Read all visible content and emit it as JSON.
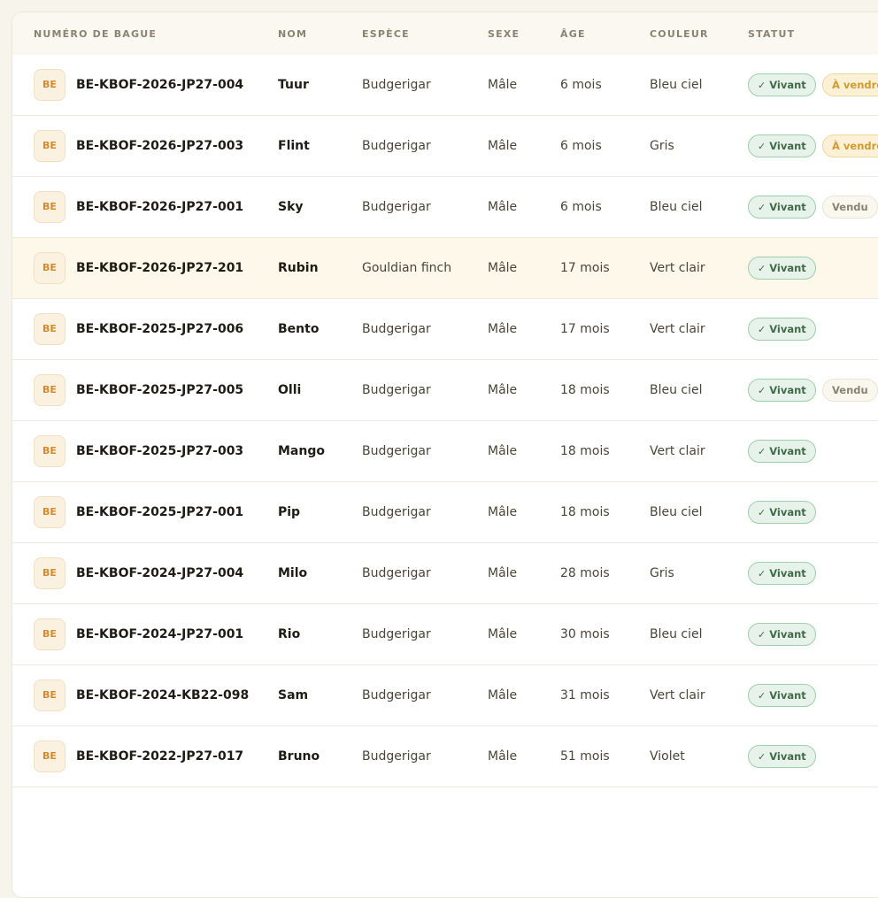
{
  "table": {
    "columns": [
      "Numéro de bague",
      "Nom",
      "Espèce",
      "Sexe",
      "Âge",
      "Couleur",
      "Statut"
    ],
    "rows": [
      {
        "country": "BE",
        "ring": "BE-KBOF-2026-JP27-004",
        "name": "Tuur",
        "species": "Budgerigar",
        "sex": "Mâle",
        "age": "6 mois",
        "color": "Bleu ciel",
        "status": "Vivant",
        "extra": "À vendre",
        "extra_type": "avendre",
        "highlight": false
      },
      {
        "country": "BE",
        "ring": "BE-KBOF-2026-JP27-003",
        "name": "Flint",
        "species": "Budgerigar",
        "sex": "Mâle",
        "age": "6 mois",
        "color": "Gris",
        "status": "Vivant",
        "extra": "À vendre",
        "extra_type": "avendre",
        "highlight": false
      },
      {
        "country": "BE",
        "ring": "BE-KBOF-2026-JP27-001",
        "name": "Sky",
        "species": "Budgerigar",
        "sex": "Mâle",
        "age": "6 mois",
        "color": "Bleu ciel",
        "status": "Vivant",
        "extra": "Vendu",
        "extra_type": "vendu",
        "highlight": false
      },
      {
        "country": "BE",
        "ring": "BE-KBOF-2026-JP27-201",
        "name": "Rubin",
        "species": "Gouldian finch",
        "sex": "Mâle",
        "age": "17 mois",
        "color": "Vert clair",
        "status": "Vivant",
        "extra": "",
        "extra_type": "",
        "highlight": true
      },
      {
        "country": "BE",
        "ring": "BE-KBOF-2025-JP27-006",
        "name": "Bento",
        "species": "Budgerigar",
        "sex": "Mâle",
        "age": "17 mois",
        "color": "Vert clair",
        "status": "Vivant",
        "extra": "",
        "extra_type": "",
        "highlight": false
      },
      {
        "country": "BE",
        "ring": "BE-KBOF-2025-JP27-005",
        "name": "Olli",
        "species": "Budgerigar",
        "sex": "Mâle",
        "age": "18 mois",
        "color": "Bleu ciel",
        "status": "Vivant",
        "extra": "Vendu",
        "extra_type": "vendu",
        "highlight": false
      },
      {
        "country": "BE",
        "ring": "BE-KBOF-2025-JP27-003",
        "name": "Mango",
        "species": "Budgerigar",
        "sex": "Mâle",
        "age": "18 mois",
        "color": "Vert clair",
        "status": "Vivant",
        "extra": "",
        "extra_type": "",
        "highlight": false
      },
      {
        "country": "BE",
        "ring": "BE-KBOF-2025-JP27-001",
        "name": "Pip",
        "species": "Budgerigar",
        "sex": "Mâle",
        "age": "18 mois",
        "color": "Bleu ciel",
        "status": "Vivant",
        "extra": "",
        "extra_type": "",
        "highlight": false
      },
      {
        "country": "BE",
        "ring": "BE-KBOF-2024-JP27-004",
        "name": "Milo",
        "species": "Budgerigar",
        "sex": "Mâle",
        "age": "28 mois",
        "color": "Gris",
        "status": "Vivant",
        "extra": "",
        "extra_type": "",
        "highlight": false
      },
      {
        "country": "BE",
        "ring": "BE-KBOF-2024-JP27-001",
        "name": "Rio",
        "species": "Budgerigar",
        "sex": "Mâle",
        "age": "30 mois",
        "color": "Bleu ciel",
        "status": "Vivant",
        "extra": "",
        "extra_type": "",
        "highlight": false
      },
      {
        "country": "BE",
        "ring": "BE-KBOF-2024-KB22-098",
        "name": "Sam",
        "species": "Budgerigar",
        "sex": "Mâle",
        "age": "31 mois",
        "color": "Vert clair",
        "status": "Vivant",
        "extra": "",
        "extra_type": "",
        "highlight": false
      },
      {
        "country": "BE",
        "ring": "BE-KBOF-2022-JP27-017",
        "name": "Bruno",
        "species": "Budgerigar",
        "sex": "Mâle",
        "age": "51 mois",
        "color": "Violet",
        "status": "Vivant",
        "extra": "",
        "extra_type": "",
        "highlight": false
      }
    ]
  },
  "icons": {
    "status_check": "check-icon"
  },
  "colors": {
    "background": "#f7f4ec",
    "highlight_row": "#fdf8ea",
    "vivant_bg": "#e7f3ea",
    "vivant_text": "#3f6b48",
    "avendre_bg": "#fcf1d7",
    "avendre_text": "#d49a2b",
    "vendu_text": "#8a8372",
    "country_badge_text": "#d28b2e"
  }
}
